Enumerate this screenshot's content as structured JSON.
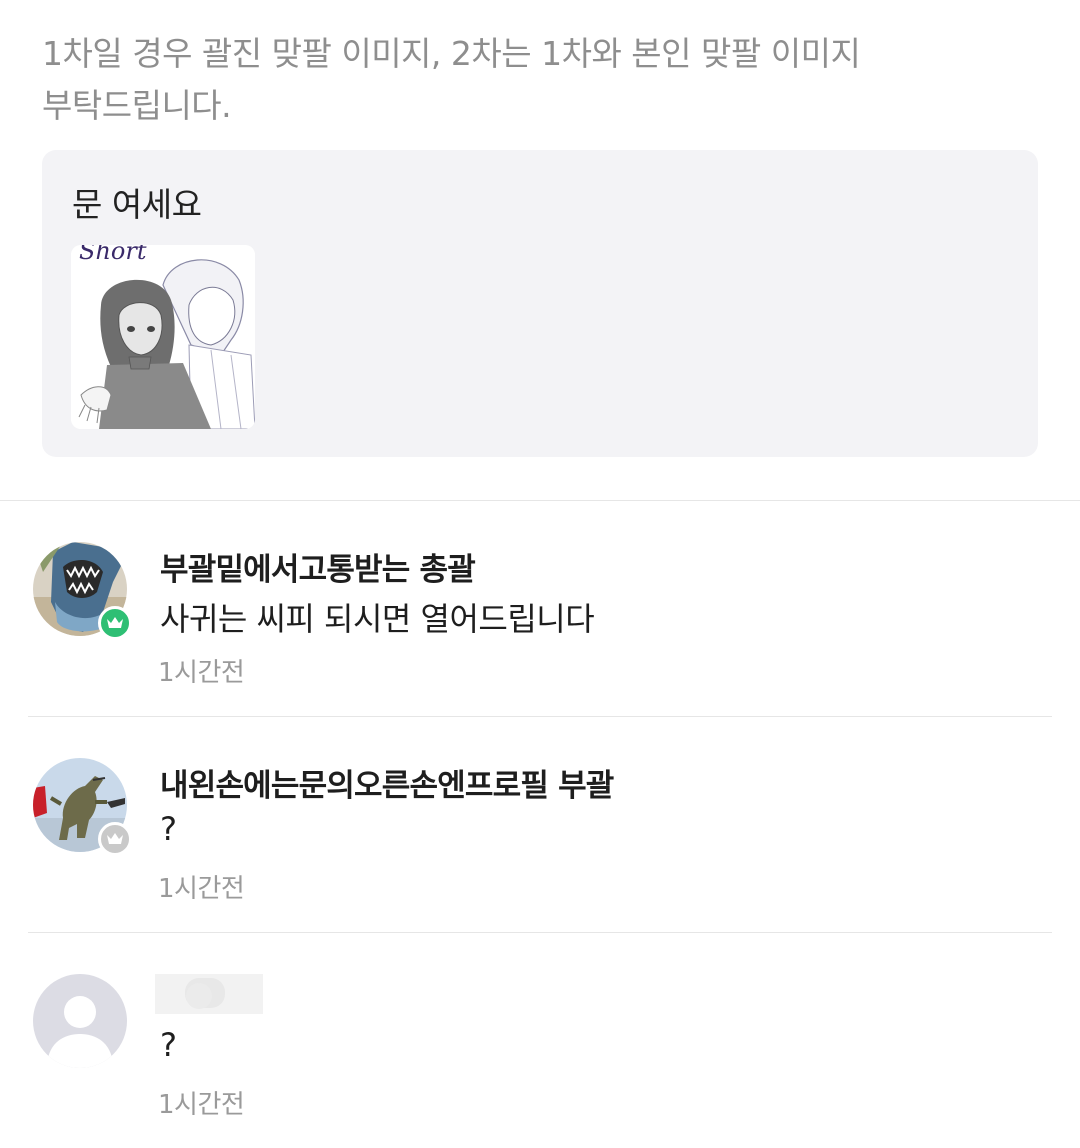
{
  "post": {
    "notice_lines": [
      "1차일 경우 괄진 맞팔 이미지, 2차는 1차와 본인 맞팔 이미지",
      "부탁드립니다."
    ]
  },
  "quote": {
    "text": "문 여세요",
    "thumb_caption": "Short"
  },
  "comments": [
    {
      "author": "부괄밑에서고통받는 총괄",
      "body": "사귀는 씨피 되시면 열어드립니다",
      "time": "1시간전",
      "badge": "crown-green"
    },
    {
      "author": "내왼손에는문의오른손엔프로필 부괄",
      "body": "?",
      "time": "1시간전",
      "badge": "crown-gray"
    },
    {
      "author": "",
      "body": "?",
      "time": "1시간전",
      "badge": ""
    }
  ],
  "colors": {
    "badge_green": "#2ebf74",
    "badge_gray": "#c9c9c9",
    "muted_text": "#8e8e8e",
    "quote_bg": "#f3f3f6"
  }
}
